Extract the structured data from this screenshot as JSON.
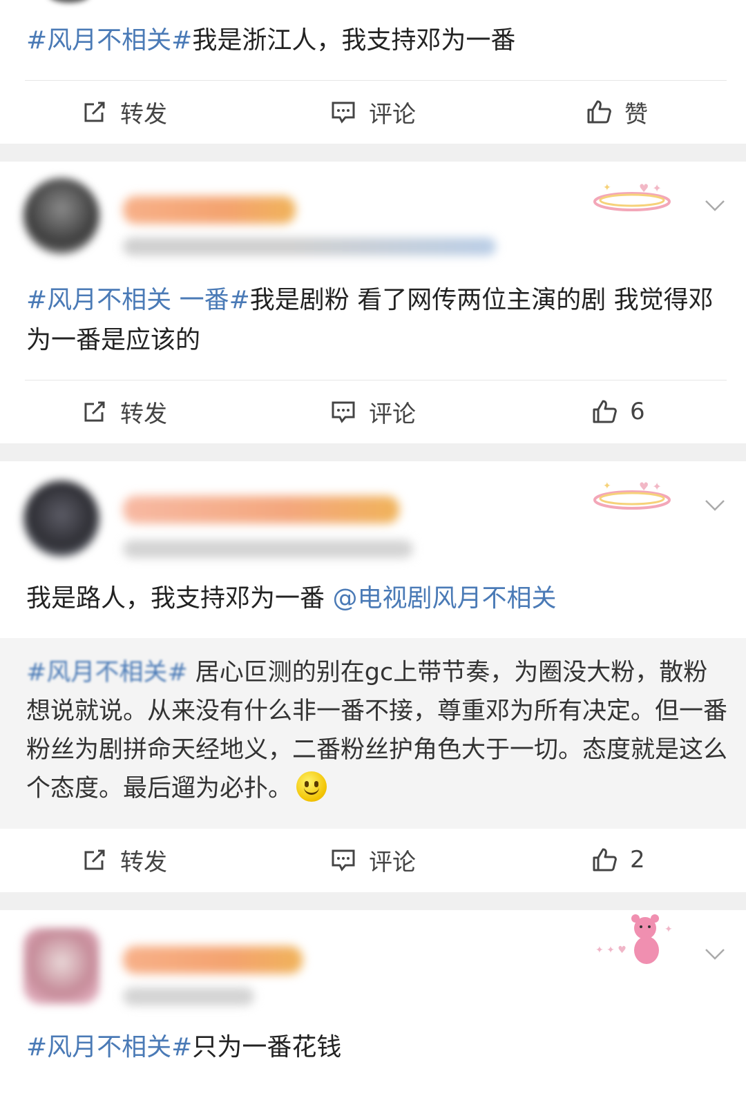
{
  "posts": [
    {
      "hashtag": "#风月不相关#",
      "text": "我是浙江人，我支持邓为一番",
      "actions": {
        "repost": "转发",
        "comment": "评论",
        "like": "赞"
      }
    },
    {
      "hashtag": "#风月不相关 一番#",
      "text": "我是剧粉 看了网传两位主演的剧 我觉得邓为一番是应该的",
      "actions": {
        "repost": "转发",
        "comment": "评论",
        "like": "6"
      }
    },
    {
      "text": "我是路人，我支持邓为一番 ",
      "mention": "@电视剧风月不相关",
      "quote": {
        "hashtag": "#风月不相关#",
        "text": " 居心叵测的别在gc上带节奏，为圈没大粉，散粉想说就说。从来没有什么非一番不接，尊重邓为所有决定。但一番粉丝为剧拼命天经地义，二番粉丝护角色大于一切。态度就是这么个态度。最后遛为必扑。"
      },
      "actions": {
        "repost": "转发",
        "comment": "评论",
        "like": "2"
      }
    },
    {
      "hashtag": "#风月不相关#",
      "text": "只为一番花钱"
    }
  ],
  "icons": {
    "repost": "share-edit-icon",
    "comment": "comment-icon",
    "like": "thumbs-up-icon",
    "more": "chevron-down-icon",
    "emoji": "smile-emoji-icon"
  },
  "colors": {
    "hashtag": "#4a7ab6",
    "separator": "#f0f0f0",
    "action_text": "#444444"
  }
}
